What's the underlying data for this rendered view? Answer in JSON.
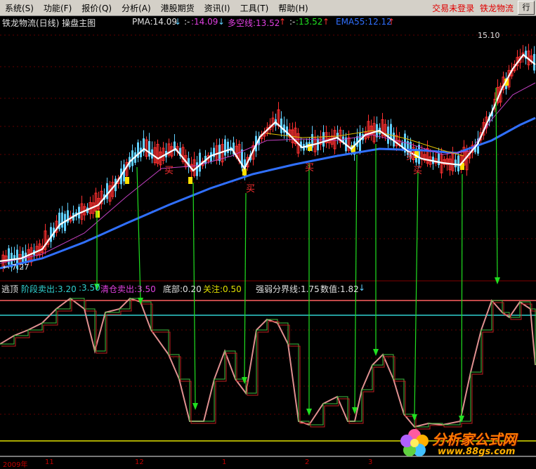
{
  "menu": {
    "items": [
      "系统(S)",
      "功能(F)",
      "报价(Q)",
      "分析(A)",
      "港股期货",
      "资讯(I)",
      "工具(T)",
      "帮助(H)"
    ],
    "status_login": "交易未登录",
    "status_stock": "铁龙物流",
    "right_button": "行"
  },
  "price_panel": {
    "title": "铁龙物流(日线) 操盘主图",
    "pma": "PMA:14.09",
    "pma_arrow": "↓",
    "dash1": ":-",
    "dash1_value": ":14.09",
    "dash1_arrow": "↓",
    "duokong": "多空线:13.52",
    "duokong_arrow": "↑",
    "dash2": ":-",
    "dash2_value": ":13.52",
    "dash2_arrow": "↑",
    "ema": "EMA55:12.12",
    "ema_arrow": "↑",
    "high_label": "15.10",
    "low_label": "← 7.27",
    "buy_label": "买",
    "colors": {
      "white_line": "#ffffff",
      "ema_line": "#3070ff",
      "pma_line": "#c040c0",
      "yellow_line": "#e0c000",
      "up": "#ff3030",
      "down": "#60d0ff",
      "buy": "#ff3030"
    }
  },
  "indicator_panel": {
    "name": "逃顶",
    "stage_sell": "阶段卖出:3.20",
    "stage_sell_2": ":3.50",
    "clear_sell": "清仓卖出:3.50",
    "bottom": "底部:0.20",
    "attention": "关注:0.50",
    "strong_weak": "强弱分界线:1.75",
    "value": "数值:1.82",
    "value_arrow": "↓",
    "colors": {
      "top_line": "#ff6060",
      "cyan_line": "#30d0d0",
      "yellow_line": "#e0e000",
      "arrow": "#20e020"
    }
  },
  "time_axis": {
    "labels": [
      "2009年",
      "11",
      "12",
      "1",
      "2",
      "3"
    ]
  },
  "logo": {
    "brand": "分析家公式网",
    "url": "www.88gs.com"
  }
}
